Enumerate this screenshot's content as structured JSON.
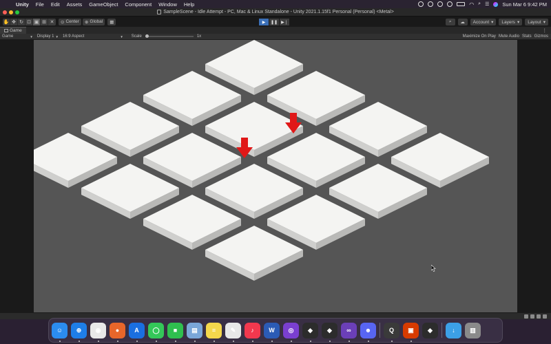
{
  "menubar": {
    "app": "Unity",
    "items": [
      "File",
      "Edit",
      "Assets",
      "GameObject",
      "Component",
      "Window",
      "Help"
    ],
    "clock": "Sun Mar 6  9:42 PM"
  },
  "window": {
    "title": "SampleScene - Idle Attempt - PC, Mac & Linux Standalone - Unity 2021.1.15f1 Personal (Personal) <Metal>"
  },
  "toolbar": {
    "pivot_label": "Center",
    "space_label": "Global",
    "account_label": "Account",
    "layers_label": "Layers",
    "layout_label": "Layout"
  },
  "game_tab": {
    "label": "Game"
  },
  "game_bar": {
    "mode": "Game",
    "display": "Display 1",
    "aspect": "16:9 Aspect",
    "scale_label": "Scale",
    "scale_value": "1x",
    "maximize": "Maximize On Play",
    "mute": "Mute Audio",
    "stats": "Stats",
    "gizmos": "Gizmos"
  },
  "colors": {
    "tile_top": "#f4f4f2",
    "tile_left": "#cfcfcd",
    "tile_right": "#b9b9b7",
    "arrow": "#e01818",
    "canvas_bg": "#555555"
  },
  "scene": {
    "tile_count": 16,
    "arrow_count": 2
  },
  "dock": {
    "apps": [
      {
        "name": "finder-icon",
        "color": "#2b8cf0",
        "glyph": "☺"
      },
      {
        "name": "safari-icon",
        "color": "#1e7ee8",
        "glyph": "⊕"
      },
      {
        "name": "chrome-icon",
        "color": "#e9e9e9",
        "glyph": "◉"
      },
      {
        "name": "firefox-icon",
        "color": "#e8662a",
        "glyph": "●"
      },
      {
        "name": "app-store-icon",
        "color": "#1a6fe0",
        "glyph": "A"
      },
      {
        "name": "messages-icon",
        "color": "#34c759",
        "glyph": "◯"
      },
      {
        "name": "facetime-icon",
        "color": "#2fbf4f",
        "glyph": "■"
      },
      {
        "name": "preview-icon",
        "color": "#7aa6d8",
        "glyph": "▤"
      },
      {
        "name": "notes-icon",
        "color": "#f5d74c",
        "glyph": "≡"
      },
      {
        "name": "textedit-icon",
        "color": "#e8e8e8",
        "glyph": "✎"
      },
      {
        "name": "music-icon",
        "color": "#f2384e",
        "glyph": "♪"
      },
      {
        "name": "word-icon",
        "color": "#2b5bb5",
        "glyph": "W"
      },
      {
        "name": "github-icon",
        "color": "#7a3fd0",
        "glyph": "◎"
      },
      {
        "name": "unity-hub-icon",
        "color": "#2c2c2c",
        "glyph": "◆"
      },
      {
        "name": "unity-icon",
        "color": "#2c2c2c",
        "glyph": "◆"
      },
      {
        "name": "visual-studio-icon",
        "color": "#6b3fb8",
        "glyph": "∞"
      },
      {
        "name": "discord-icon",
        "color": "#5865f2",
        "glyph": "☻"
      },
      {
        "name": "quicktime-icon",
        "color": "#3a3a3a",
        "glyph": "Q"
      },
      {
        "name": "office-icon",
        "color": "#d83b01",
        "glyph": "▣"
      },
      {
        "name": "unity-editor-icon",
        "color": "#2c2c2c",
        "glyph": "◆"
      },
      {
        "name": "downloads-folder-icon",
        "color": "#3ca0e6",
        "glyph": "↓"
      },
      {
        "name": "trash-icon",
        "color": "#8a8a8a",
        "glyph": "▥"
      }
    ]
  }
}
